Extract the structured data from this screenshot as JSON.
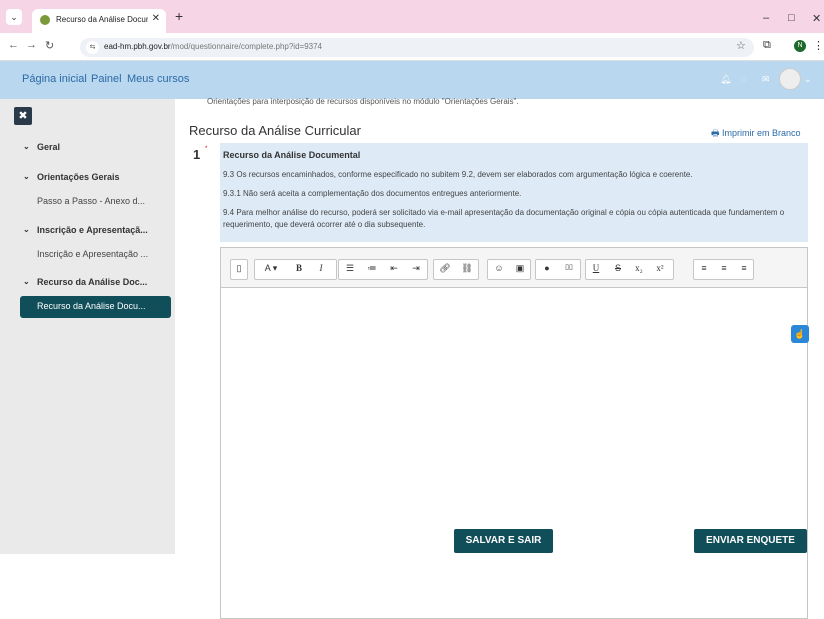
{
  "browser": {
    "tab_title": "Recurso da Análise Documenta",
    "url_host": "ead-hm.pbh.gov.br",
    "url_path": "/mod/questionnaire/complete.php?id=9374",
    "profile_initial": "N"
  },
  "topnav": {
    "links": [
      "Página inicial",
      "Painel",
      "Meus cursos"
    ]
  },
  "sidebar": {
    "sections": [
      {
        "label": "Geral"
      },
      {
        "label": "Orientações Gerais",
        "item": "Passo a Passo - Anexo d..."
      },
      {
        "label": "Inscrição e Apresentaçã...",
        "item": "Inscrição e Apresentação ..."
      },
      {
        "label": "Recurso da Análise Doc...",
        "item": "Recurso da Análise Docu..."
      }
    ]
  },
  "main": {
    "clipped_text": "Orientações para interposição de recursos disponíveis no módulo \"Orientações Gerais\".",
    "heading": "Recurso da Análise Curricular",
    "print_label": "Imprimir em Branco",
    "question": {
      "number": "1",
      "required_mark": "*",
      "title": "Recurso da Análise Documental",
      "paragraphs": [
        "9.3 Os recursos encaminhados, conforme especificado no subitem 9.2, devem ser elaborados com argumentação lógica e coerente.",
        "9.3.1 Não será aceita a complementação dos documentos entregues anteriormente.",
        "9.4 Para melhor análise do recurso, poderá ser solicitado via e-mail apresentação da documentação original e cópia ou cópia autenticada que fundamentem o requerimento, que deverá ocorrer até o dia subsequente."
      ]
    },
    "buttons": {
      "save": "SALVAR E SAIR",
      "submit": "ENVIAR ENQUETE"
    }
  },
  "colors": {
    "accent": "#104e5a",
    "nav_bg": "#b9d7ee",
    "question_bg": "#deebf7"
  }
}
